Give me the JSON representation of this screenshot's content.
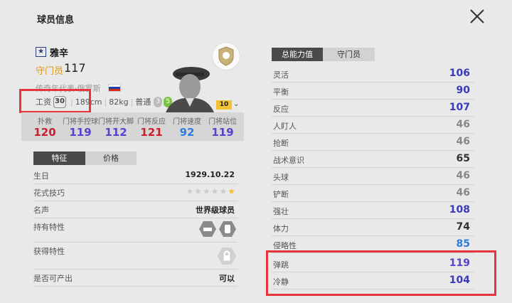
{
  "header": {
    "title": "球员信息"
  },
  "player": {
    "name": "雅辛",
    "position": "守门员",
    "overall": "117",
    "club": "传奇年代表·俄罗斯",
    "wage_label": "工资",
    "wage": "30",
    "height": "189cm",
    "weight": "82kg",
    "body_type": "普通",
    "weak_foot": "3",
    "skill_moves": "5",
    "level": "10"
  },
  "gk_stats": [
    {
      "label": "扑救",
      "value": "120",
      "color": "#c8202b"
    },
    {
      "label": "门将手控球",
      "value": "119",
      "color": "#5b3fd0"
    },
    {
      "label": "门将开大脚",
      "value": "112",
      "color": "#5b3fd0"
    },
    {
      "label": "门将反应",
      "value": "121",
      "color": "#c8202b"
    },
    {
      "label": "门将速度",
      "value": "92",
      "color": "#2d7be0"
    },
    {
      "label": "门将站位",
      "value": "119",
      "color": "#5b3fd0"
    }
  ],
  "left_tabs": {
    "active": "特征",
    "inactive": "价格"
  },
  "info": [
    {
      "key": "生日",
      "value": "1929.10.22"
    },
    {
      "key": "花式技巧",
      "value": ""
    },
    {
      "key": "名声",
      "value": "世界级球员"
    },
    {
      "key": "持有特性",
      "value": ""
    },
    {
      "key": "获得特性",
      "value": ""
    },
    {
      "key": "是否可产出",
      "value": "可以"
    }
  ],
  "right_tabs": {
    "active": "总能力值",
    "inactive": "守门员"
  },
  "stats": [
    {
      "label": "灵活",
      "value": "106",
      "color": "#3a3ab8"
    },
    {
      "label": "平衡",
      "value": "90",
      "color": "#3a3ab8"
    },
    {
      "label": "反应",
      "value": "107",
      "color": "#3a3ab8"
    },
    {
      "label": "人盯人",
      "value": "46",
      "color": "#888888"
    },
    {
      "label": "抢断",
      "value": "46",
      "color": "#888888"
    },
    {
      "label": "战术意识",
      "value": "65",
      "color": "#333333"
    },
    {
      "label": "头球",
      "value": "46",
      "color": "#888888"
    },
    {
      "label": "铲断",
      "value": "46",
      "color": "#888888"
    },
    {
      "label": "强壮",
      "value": "108",
      "color": "#3a3ab8"
    },
    {
      "label": "体力",
      "value": "74",
      "color": "#333333"
    },
    {
      "label": "侵略性",
      "value": "85",
      "color": "#2d7be0"
    },
    {
      "label": "弹跳",
      "value": "119",
      "color": "#5b3fd0"
    },
    {
      "label": "冷静",
      "value": "104",
      "color": "#3a3ab8"
    }
  ]
}
